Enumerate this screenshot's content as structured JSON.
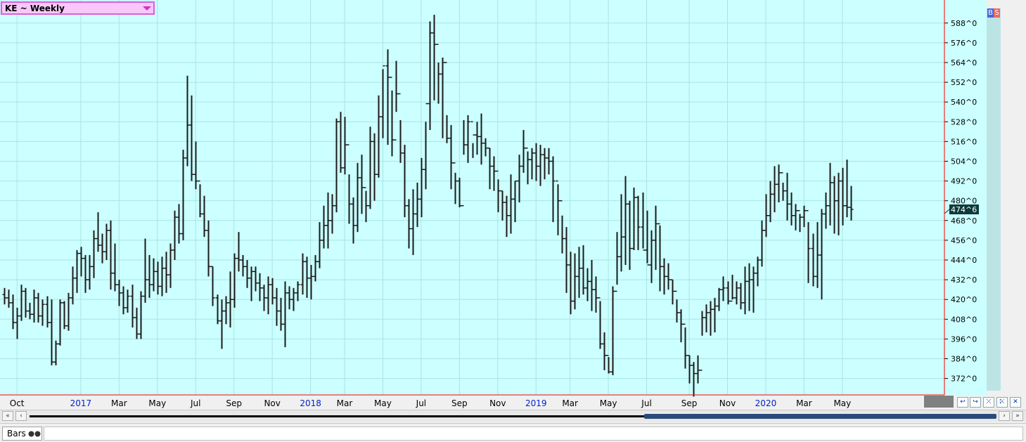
{
  "symbol_selector": {
    "label": "KE ~ Weekly"
  },
  "bs_buttons": {
    "buy": "B",
    "sell": "S"
  },
  "bottom": {
    "chart_style": "Bars"
  },
  "colors": {
    "background": "#ccffff",
    "grid": "#a8e4e4",
    "bar": "#1a1a1a",
    "frame": "#ff0000",
    "year_label": "#0022cc",
    "last_price_bg": "#0f3a3a",
    "last_price_text": "#ffffff"
  },
  "chart_data": {
    "type": "ohlc",
    "instrument": "KE",
    "interval": "Weekly",
    "last_price_label": "474^6",
    "last_price": 474.75,
    "ylim": [
      362,
      602
    ],
    "y_ticks": [
      {
        "value": 372,
        "label": "372^0"
      },
      {
        "value": 384,
        "label": "384^0"
      },
      {
        "value": 396,
        "label": "396^0"
      },
      {
        "value": 408,
        "label": "408^0"
      },
      {
        "value": 420,
        "label": "420^0"
      },
      {
        "value": 432,
        "label": "432^0"
      },
      {
        "value": 444,
        "label": "444^0"
      },
      {
        "value": 456,
        "label": "456^0"
      },
      {
        "value": 468,
        "label": "468^0"
      },
      {
        "value": 480,
        "label": "480^0"
      },
      {
        "value": 492,
        "label": "492^0"
      },
      {
        "value": 504,
        "label": "504^0"
      },
      {
        "value": 516,
        "label": "516^0"
      },
      {
        "value": 528,
        "label": "528^0"
      },
      {
        "value": 540,
        "label": "540^0"
      },
      {
        "value": 552,
        "label": "552^0"
      },
      {
        "value": 564,
        "label": "564^0"
      },
      {
        "value": 576,
        "label": "576^0"
      },
      {
        "value": 588,
        "label": "588^0"
      }
    ],
    "x_ticks": [
      {
        "index": 3,
        "label": "Oct",
        "year": false
      },
      {
        "index": 18,
        "label": "2017",
        "year": true
      },
      {
        "index": 27,
        "label": "Mar",
        "year": false
      },
      {
        "index": 36,
        "label": "May",
        "year": false
      },
      {
        "index": 45,
        "label": "Jul",
        "year": false
      },
      {
        "index": 54,
        "label": "Sep",
        "year": false
      },
      {
        "index": 63,
        "label": "Nov",
        "year": false
      },
      {
        "index": 72,
        "label": "2018",
        "year": true
      },
      {
        "index": 80,
        "label": "Mar",
        "year": false
      },
      {
        "index": 89,
        "label": "May",
        "year": false
      },
      {
        "index": 98,
        "label": "Jul",
        "year": false
      },
      {
        "index": 107,
        "label": "Sep",
        "year": false
      },
      {
        "index": 116,
        "label": "Nov",
        "year": false
      },
      {
        "index": 125,
        "label": "2019",
        "year": true
      },
      {
        "index": 133,
        "label": "Mar",
        "year": false
      },
      {
        "index": 142,
        "label": "May",
        "year": false
      },
      {
        "index": 151,
        "label": "Jul",
        "year": false
      },
      {
        "index": 161,
        "label": "Sep",
        "year": false
      },
      {
        "index": 170,
        "label": "Nov",
        "year": false
      },
      {
        "index": 179,
        "label": "2020",
        "year": true
      },
      {
        "index": 188,
        "label": "Mar",
        "year": false
      },
      {
        "index": 197,
        "label": "May",
        "year": false
      }
    ],
    "bars": [
      [
        423,
        427,
        417,
        421
      ],
      [
        421,
        426,
        415,
        418
      ],
      [
        418,
        423,
        402,
        406
      ],
      [
        406,
        415,
        396,
        410
      ],
      [
        410,
        429,
        407,
        425
      ],
      [
        425,
        427,
        409,
        413
      ],
      [
        413,
        418,
        408,
        411
      ],
      [
        411,
        426,
        406,
        421
      ],
      [
        421,
        424,
        406,
        410
      ],
      [
        410,
        420,
        404,
        417
      ],
      [
        417,
        422,
        403,
        406
      ],
      [
        406,
        420,
        380,
        382
      ],
      [
        382,
        395,
        380,
        393
      ],
      [
        393,
        420,
        392,
        418
      ],
      [
        418,
        419,
        402,
        404
      ],
      [
        404,
        424,
        401,
        421
      ],
      [
        421,
        440,
        417,
        433
      ],
      [
        433,
        450,
        424,
        448
      ],
      [
        448,
        452,
        434,
        445
      ],
      [
        445,
        447,
        424,
        432
      ],
      [
        432,
        447,
        426,
        440
      ],
      [
        440,
        462,
        433,
        457
      ],
      [
        457,
        473,
        449,
        453
      ],
      [
        453,
        460,
        442,
        449
      ],
      [
        449,
        466,
        444,
        462
      ],
      [
        462,
        468,
        426,
        436
      ],
      [
        436,
        454,
        425,
        429
      ],
      [
        429,
        432,
        416,
        424
      ],
      [
        424,
        428,
        411,
        415
      ],
      [
        415,
        426,
        412,
        422
      ],
      [
        422,
        429,
        403,
        409
      ],
      [
        409,
        415,
        396,
        399
      ],
      [
        399,
        425,
        396,
        422
      ],
      [
        422,
        457,
        418,
        432
      ],
      [
        432,
        447,
        421,
        429
      ],
      [
        429,
        445,
        425,
        437
      ],
      [
        437,
        443,
        423,
        428
      ],
      [
        428,
        446,
        422,
        439
      ],
      [
        439,
        449,
        424,
        435
      ],
      [
        435,
        454,
        427,
        450
      ],
      [
        450,
        474,
        444,
        470
      ],
      [
        470,
        478,
        454,
        460
      ],
      [
        460,
        511,
        456,
        506
      ],
      [
        506,
        556,
        501,
        526
      ],
      [
        526,
        544,
        492,
        496
      ],
      [
        496,
        516,
        487,
        492
      ],
      [
        492,
        490,
        470,
        472
      ],
      [
        472,
        483,
        458,
        462
      ],
      [
        462,
        468,
        434,
        440
      ],
      [
        440,
        440,
        416,
        421
      ],
      [
        421,
        423,
        405,
        407
      ],
      [
        407,
        420,
        390,
        413
      ],
      [
        413,
        422,
        405,
        418
      ],
      [
        418,
        437,
        403,
        420
      ],
      [
        420,
        448,
        415,
        445
      ],
      [
        445,
        461,
        437,
        444
      ],
      [
        444,
        447,
        434,
        440
      ],
      [
        440,
        444,
        427,
        433
      ],
      [
        433,
        440,
        419,
        437
      ],
      [
        437,
        440,
        425,
        430
      ],
      [
        430,
        436,
        419,
        427
      ],
      [
        427,
        429,
        413,
        421
      ],
      [
        421,
        434,
        411,
        429
      ],
      [
        429,
        433,
        417,
        421
      ],
      [
        421,
        427,
        404,
        413
      ],
      [
        413,
        421,
        401,
        405
      ],
      [
        405,
        431,
        391,
        424
      ],
      [
        424,
        428,
        414,
        420
      ],
      [
        420,
        427,
        413,
        424
      ],
      [
        424,
        431,
        419,
        429
      ],
      [
        429,
        448,
        423,
        443
      ],
      [
        443,
        446,
        421,
        433
      ],
      [
        433,
        441,
        420,
        434
      ],
      [
        434,
        447,
        431,
        443
      ],
      [
        443,
        467,
        439,
        456
      ],
      [
        456,
        477,
        451,
        465
      ],
      [
        465,
        485,
        451,
        468
      ],
      [
        468,
        484,
        460,
        477
      ],
      [
        477,
        530,
        473,
        528
      ],
      [
        528,
        534,
        497,
        500
      ],
      [
        500,
        531,
        496,
        514
      ],
      [
        514,
        496,
        466,
        478
      ],
      [
        478,
        482,
        454,
        465
      ],
      [
        465,
        503,
        461,
        494
      ],
      [
        494,
        508,
        472,
        488
      ],
      [
        488,
        486,
        467,
        477
      ],
      [
        477,
        525,
        475,
        516
      ],
      [
        516,
        521,
        480,
        496
      ],
      [
        496,
        544,
        494,
        531
      ],
      [
        531,
        560,
        518,
        562
      ],
      [
        562,
        572,
        514,
        555
      ],
      [
        555,
        547,
        507,
        517
      ],
      [
        517,
        565,
        534,
        545
      ],
      [
        545,
        529,
        503,
        509
      ],
      [
        509,
        514,
        470,
        477
      ],
      [
        477,
        481,
        451,
        463
      ],
      [
        463,
        487,
        447,
        472
      ],
      [
        472,
        491,
        464,
        481
      ],
      [
        481,
        506,
        470,
        499
      ],
      [
        499,
        528,
        487,
        539
      ],
      [
        539,
        589,
        523,
        582
      ],
      [
        582,
        593,
        541,
        575
      ],
      [
        575,
        564,
        539,
        557
      ],
      [
        557,
        567,
        518,
        564
      ],
      [
        564,
        532,
        515,
        518
      ],
      [
        518,
        526,
        487,
        503
      ],
      [
        503,
        497,
        478,
        492
      ],
      [
        492,
        494,
        476,
        477
      ],
      [
        477,
        529,
        508,
        514
      ],
      [
        514,
        532,
        503,
        528
      ],
      [
        528,
        515,
        506,
        520
      ],
      [
        520,
        528,
        508,
        519
      ],
      [
        519,
        533,
        502,
        515
      ],
      [
        515,
        518,
        507,
        512
      ],
      [
        512,
        512,
        487,
        501
      ],
      [
        501,
        507,
        486,
        498
      ],
      [
        498,
        493,
        473,
        486
      ],
      [
        486,
        486,
        468,
        479
      ],
      [
        479,
        483,
        458,
        471
      ],
      [
        471,
        496,
        460,
        481
      ],
      [
        481,
        492,
        467,
        492
      ],
      [
        492,
        508,
        479,
        501
      ],
      [
        501,
        523,
        497,
        512
      ],
      [
        512,
        510,
        490,
        505
      ],
      [
        505,
        512,
        493,
        509
      ],
      [
        509,
        515,
        492,
        501
      ],
      [
        501,
        514,
        489,
        508
      ],
      [
        508,
        512,
        493,
        506
      ],
      [
        506,
        512,
        496,
        504
      ],
      [
        504,
        507,
        467,
        492
      ],
      [
        492,
        490,
        459,
        480
      ],
      [
        480,
        471,
        448,
        457
      ],
      [
        457,
        464,
        424,
        441
      ],
      [
        441,
        449,
        411,
        419
      ],
      [
        419,
        448,
        414,
        434
      ],
      [
        434,
        452,
        421,
        439
      ],
      [
        439,
        453,
        423,
        427
      ],
      [
        427,
        439,
        419,
        431
      ],
      [
        431,
        444,
        413,
        426
      ],
      [
        426,
        434,
        412,
        421
      ],
      [
        421,
        419,
        390,
        393
      ],
      [
        393,
        400,
        377,
        386
      ],
      [
        386,
        385,
        375,
        376
      ],
      [
        376,
        428,
        374,
        425
      ],
      [
        425,
        461,
        429,
        446
      ],
      [
        446,
        484,
        437,
        458
      ],
      [
        458,
        495,
        441,
        478
      ],
      [
        478,
        480,
        438,
        451
      ],
      [
        451,
        488,
        450,
        482
      ],
      [
        482,
        483,
        450,
        464
      ],
      [
        464,
        485,
        451,
        450
      ],
      [
        450,
        474,
        442,
        441
      ],
      [
        441,
        462,
        430,
        456
      ],
      [
        456,
        477,
        438,
        466
      ],
      [
        466,
        465,
        425,
        440
      ],
      [
        440,
        445,
        423,
        434
      ],
      [
        434,
        442,
        426,
        432
      ],
      [
        432,
        432,
        417,
        425
      ],
      [
        425,
        420,
        406,
        412
      ],
      [
        412,
        414,
        394,
        405
      ],
      [
        405,
        403,
        378,
        386
      ],
      [
        386,
        386,
        369,
        380
      ],
      [
        380,
        382,
        361,
        375
      ],
      [
        375,
        386,
        369,
        377
      ],
      [
        377,
        413,
        398,
        409
      ],
      [
        409,
        417,
        400,
        412
      ],
      [
        412,
        419,
        398,
        414
      ],
      [
        414,
        421,
        400,
        416
      ],
      [
        416,
        427,
        413,
        426
      ],
      [
        426,
        434,
        419,
        427
      ],
      [
        427,
        431,
        417,
        419
      ],
      [
        419,
        435,
        420,
        421
      ],
      [
        421,
        431,
        417,
        427
      ],
      [
        427,
        430,
        414,
        418
      ],
      [
        418,
        440,
        411,
        431
      ],
      [
        431,
        442,
        413,
        432
      ],
      [
        432,
        440,
        412,
        436
      ],
      [
        436,
        446,
        428,
        444
      ],
      [
        444,
        468,
        440,
        462
      ],
      [
        462,
        484,
        458,
        471
      ],
      [
        471,
        492,
        467,
        484
      ],
      [
        484,
        501,
        473,
        490
      ],
      [
        490,
        502,
        479,
        497
      ],
      [
        497,
        491,
        480,
        486
      ],
      [
        486,
        497,
        468,
        478
      ],
      [
        478,
        485,
        465,
        471
      ],
      [
        471,
        478,
        462,
        474
      ],
      [
        474,
        472,
        461,
        470
      ],
      [
        470,
        477,
        464,
        474
      ],
      [
        474,
        467,
        430,
        451
      ],
      [
        451,
        460,
        428,
        434
      ],
      [
        434,
        467,
        427,
        447
      ],
      [
        447,
        475,
        420,
        472
      ],
      [
        472,
        485,
        463,
        477
      ],
      [
        477,
        503,
        465,
        491
      ],
      [
        491,
        495,
        460,
        480
      ],
      [
        480,
        497,
        459,
        492
      ],
      [
        492,
        500,
        465,
        477
      ],
      [
        477,
        505,
        470,
        476
      ],
      [
        476,
        489,
        468,
        474.75
      ]
    ]
  }
}
